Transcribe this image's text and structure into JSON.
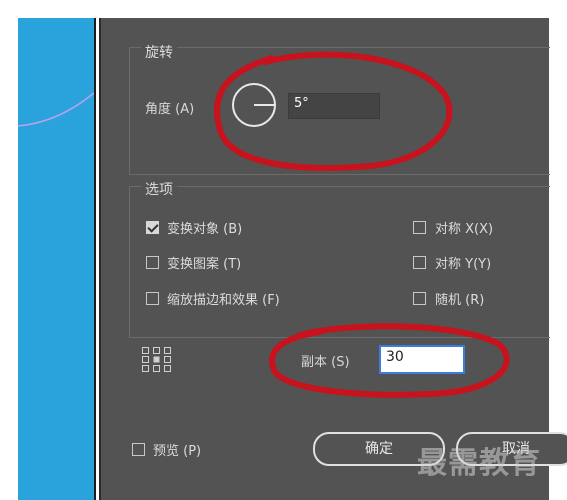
{
  "dialog": {
    "rotate_group": {
      "title": "旋转",
      "angle_label": "角度 (A)",
      "angle_value": "5°"
    },
    "options_group": {
      "title": "选项",
      "items": [
        {
          "label": "变换对象 (B)",
          "checked": true
        },
        {
          "label": "变换图案 (T)",
          "checked": false
        },
        {
          "label": "缩放描边和效果 (F)",
          "checked": false
        },
        {
          "label": "对称 X(X)",
          "checked": false
        },
        {
          "label": "对称 Y(Y)",
          "checked": false
        },
        {
          "label": "随机 (R)",
          "checked": false
        }
      ]
    },
    "copies_label": "副本 (S)",
    "copies_value": "30",
    "preview_label": "预览 (P)",
    "ok_label": "确定",
    "cancel_label": "取消"
  },
  "watermark": "最需教育",
  "colors": {
    "dialog_bg": "#535353",
    "canvas_bg": "#2aa3dc",
    "annotation": "#c8121e",
    "focus": "#3c7be3"
  },
  "icons": [
    "reference-point-grid-icon",
    "angle-dial-icon",
    "checkmark-icon"
  ]
}
